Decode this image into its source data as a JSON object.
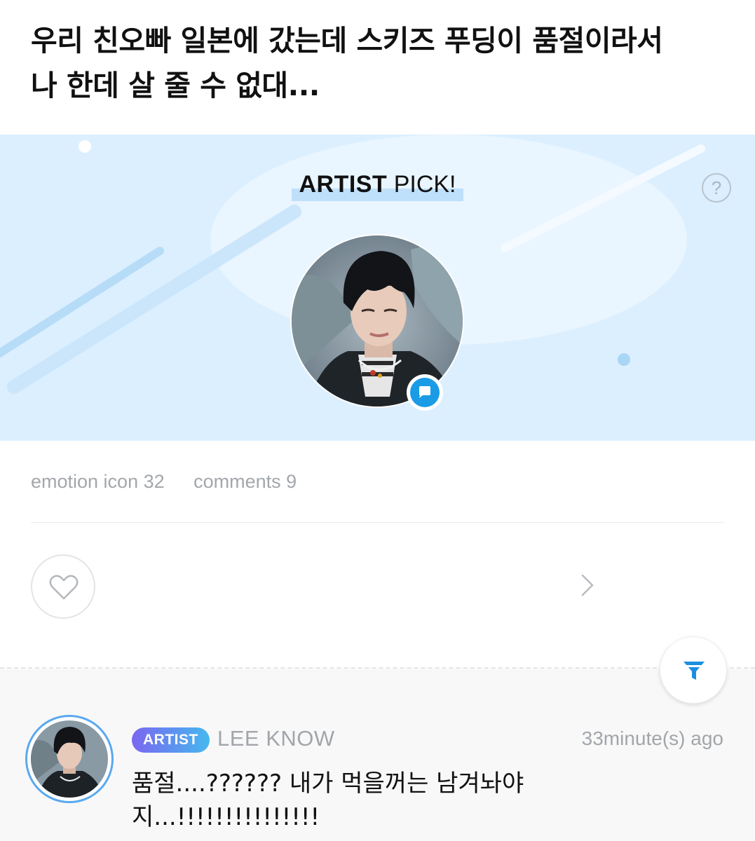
{
  "post": {
    "title_line1": "우리 친오빠 일본에 갔는데 스키즈 푸딩이 품절이라서",
    "title_line2": "나 한데 살 줄 수 없대..."
  },
  "artist_pick": {
    "title_bold": "ARTIST",
    "title_regular": "PICK!",
    "help_icon": "question-icon",
    "help_label": "?"
  },
  "stats": {
    "emotion": "emotion icon 32",
    "comments": "comments 9"
  },
  "comment": {
    "badge": "ARTIST",
    "author": "LEE KNOW",
    "time": "33minute(s) ago",
    "text_line1": "품절....?????? 내가 먹을꺼는 남겨놔야",
    "text_line2": "지...!!!!!!!!!!!!!!!"
  },
  "icons": [
    "heart-icon",
    "chevron-right-icon",
    "filter-icon",
    "chat-bubble-icon"
  ],
  "colors": {
    "banner_bg": "#dcefff",
    "accent_blue": "#1a9be6",
    "badge_gradient_start": "#7a67f0",
    "badge_gradient_end": "#45b8ef",
    "muted_text": "#a2a6aa"
  }
}
